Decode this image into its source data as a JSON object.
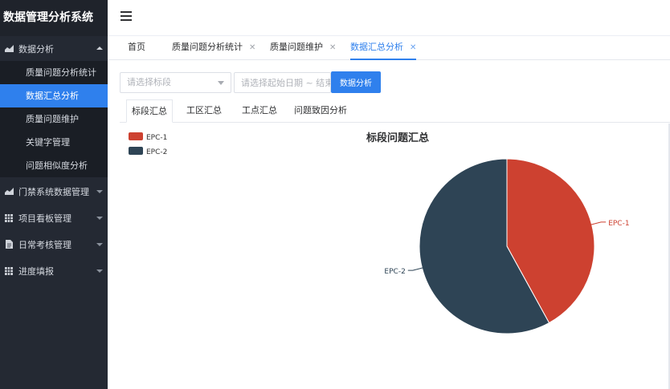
{
  "app": {
    "title": "数据管理分析系统"
  },
  "sidebar": {
    "groups": [
      {
        "label": "数据分析",
        "icon": "area-chart-icon",
        "expanded": true,
        "items": [
          "质量问题分析统计",
          "数据汇总分析",
          "质量问题维护",
          "关键字管理",
          "问题相似度分析"
        ],
        "active_item": "数据汇总分析"
      },
      {
        "label": "门禁系统数据管理",
        "icon": "area-chart-icon",
        "expanded": false
      },
      {
        "label": "项目看板管理",
        "icon": "grid-icon",
        "expanded": false
      },
      {
        "label": "日常考核管理",
        "icon": "document-icon",
        "expanded": false
      },
      {
        "label": "进度填报",
        "icon": "grid-icon",
        "expanded": false
      }
    ]
  },
  "tabs": [
    {
      "label": "首页",
      "closable": false
    },
    {
      "label": "质量问题分析统计",
      "closable": true
    },
    {
      "label": "质量问题维护",
      "closable": true
    },
    {
      "label": "数据汇总分析",
      "closable": true,
      "active": true
    }
  ],
  "filters": {
    "section_placeholder": "请选择标段",
    "date_placeholder": "请选择起始日期 ~ 结束日期",
    "analyze_label": "数据分析"
  },
  "subtabs": [
    {
      "label": "标段汇总",
      "active": true
    },
    {
      "label": "工区汇总"
    },
    {
      "label": "工点汇总"
    },
    {
      "label": "问题致因分析"
    }
  ],
  "colors": {
    "primary": "#2f80ed",
    "sidebar_bg": "#242933",
    "epc1": "#cd4130",
    "epc2": "#2e4455"
  },
  "chart_data": {
    "type": "pie",
    "title": "标段问题汇总",
    "legend_position": "top-left",
    "slices": [
      {
        "name": "EPC-1",
        "value": 42,
        "color": "#cd4130"
      },
      {
        "name": "EPC-2",
        "value": 58,
        "color": "#2e4455"
      }
    ]
  }
}
